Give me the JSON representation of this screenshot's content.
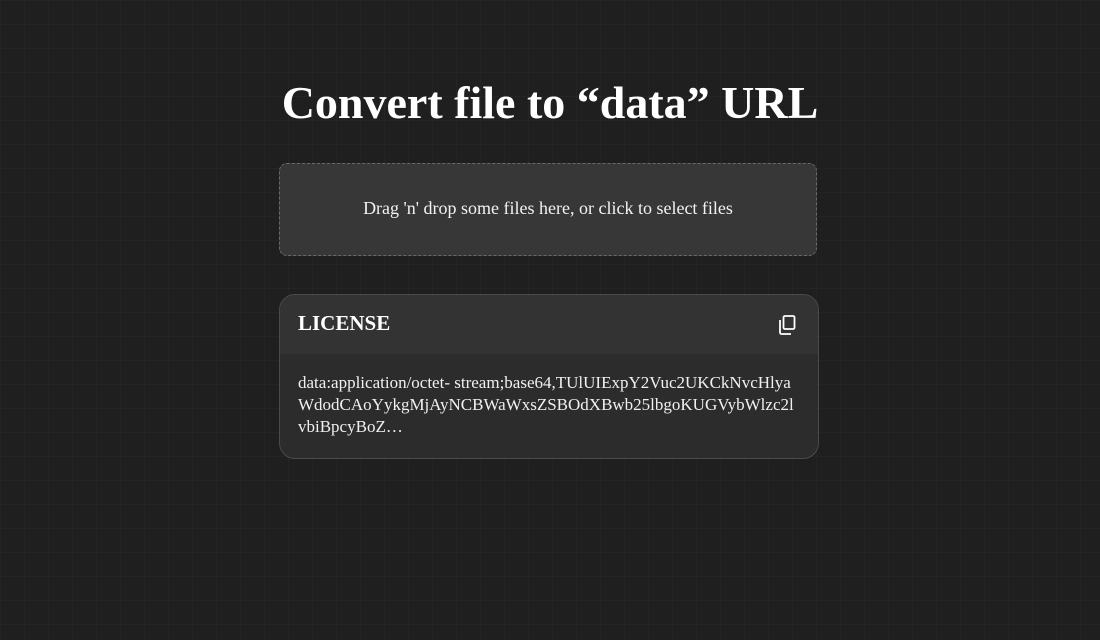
{
  "page": {
    "title": "Convert file to “data” URL"
  },
  "dropzone": {
    "prompt": "Drag 'n' drop some files here, or click to select files"
  },
  "file": {
    "name": "LICENSE",
    "copy_icon": "copy-icon",
    "data_url_line1": "data:application/octet-",
    "data_url_rest": "stream;base64,TUlUIExpY2Vuc2UKCkNvcHlyaWdodCAoYykgMjAyNCBWaWxsZSBOdXBwb25lbgoKUGVybWlzc2lvbiBpcyBoZ…"
  },
  "colors": {
    "background": "#1f1f1f",
    "dropzone_bg": "#373737",
    "card_bg": "#2c2c2c",
    "card_header_bg": "#333333",
    "text": "#ffffff"
  }
}
